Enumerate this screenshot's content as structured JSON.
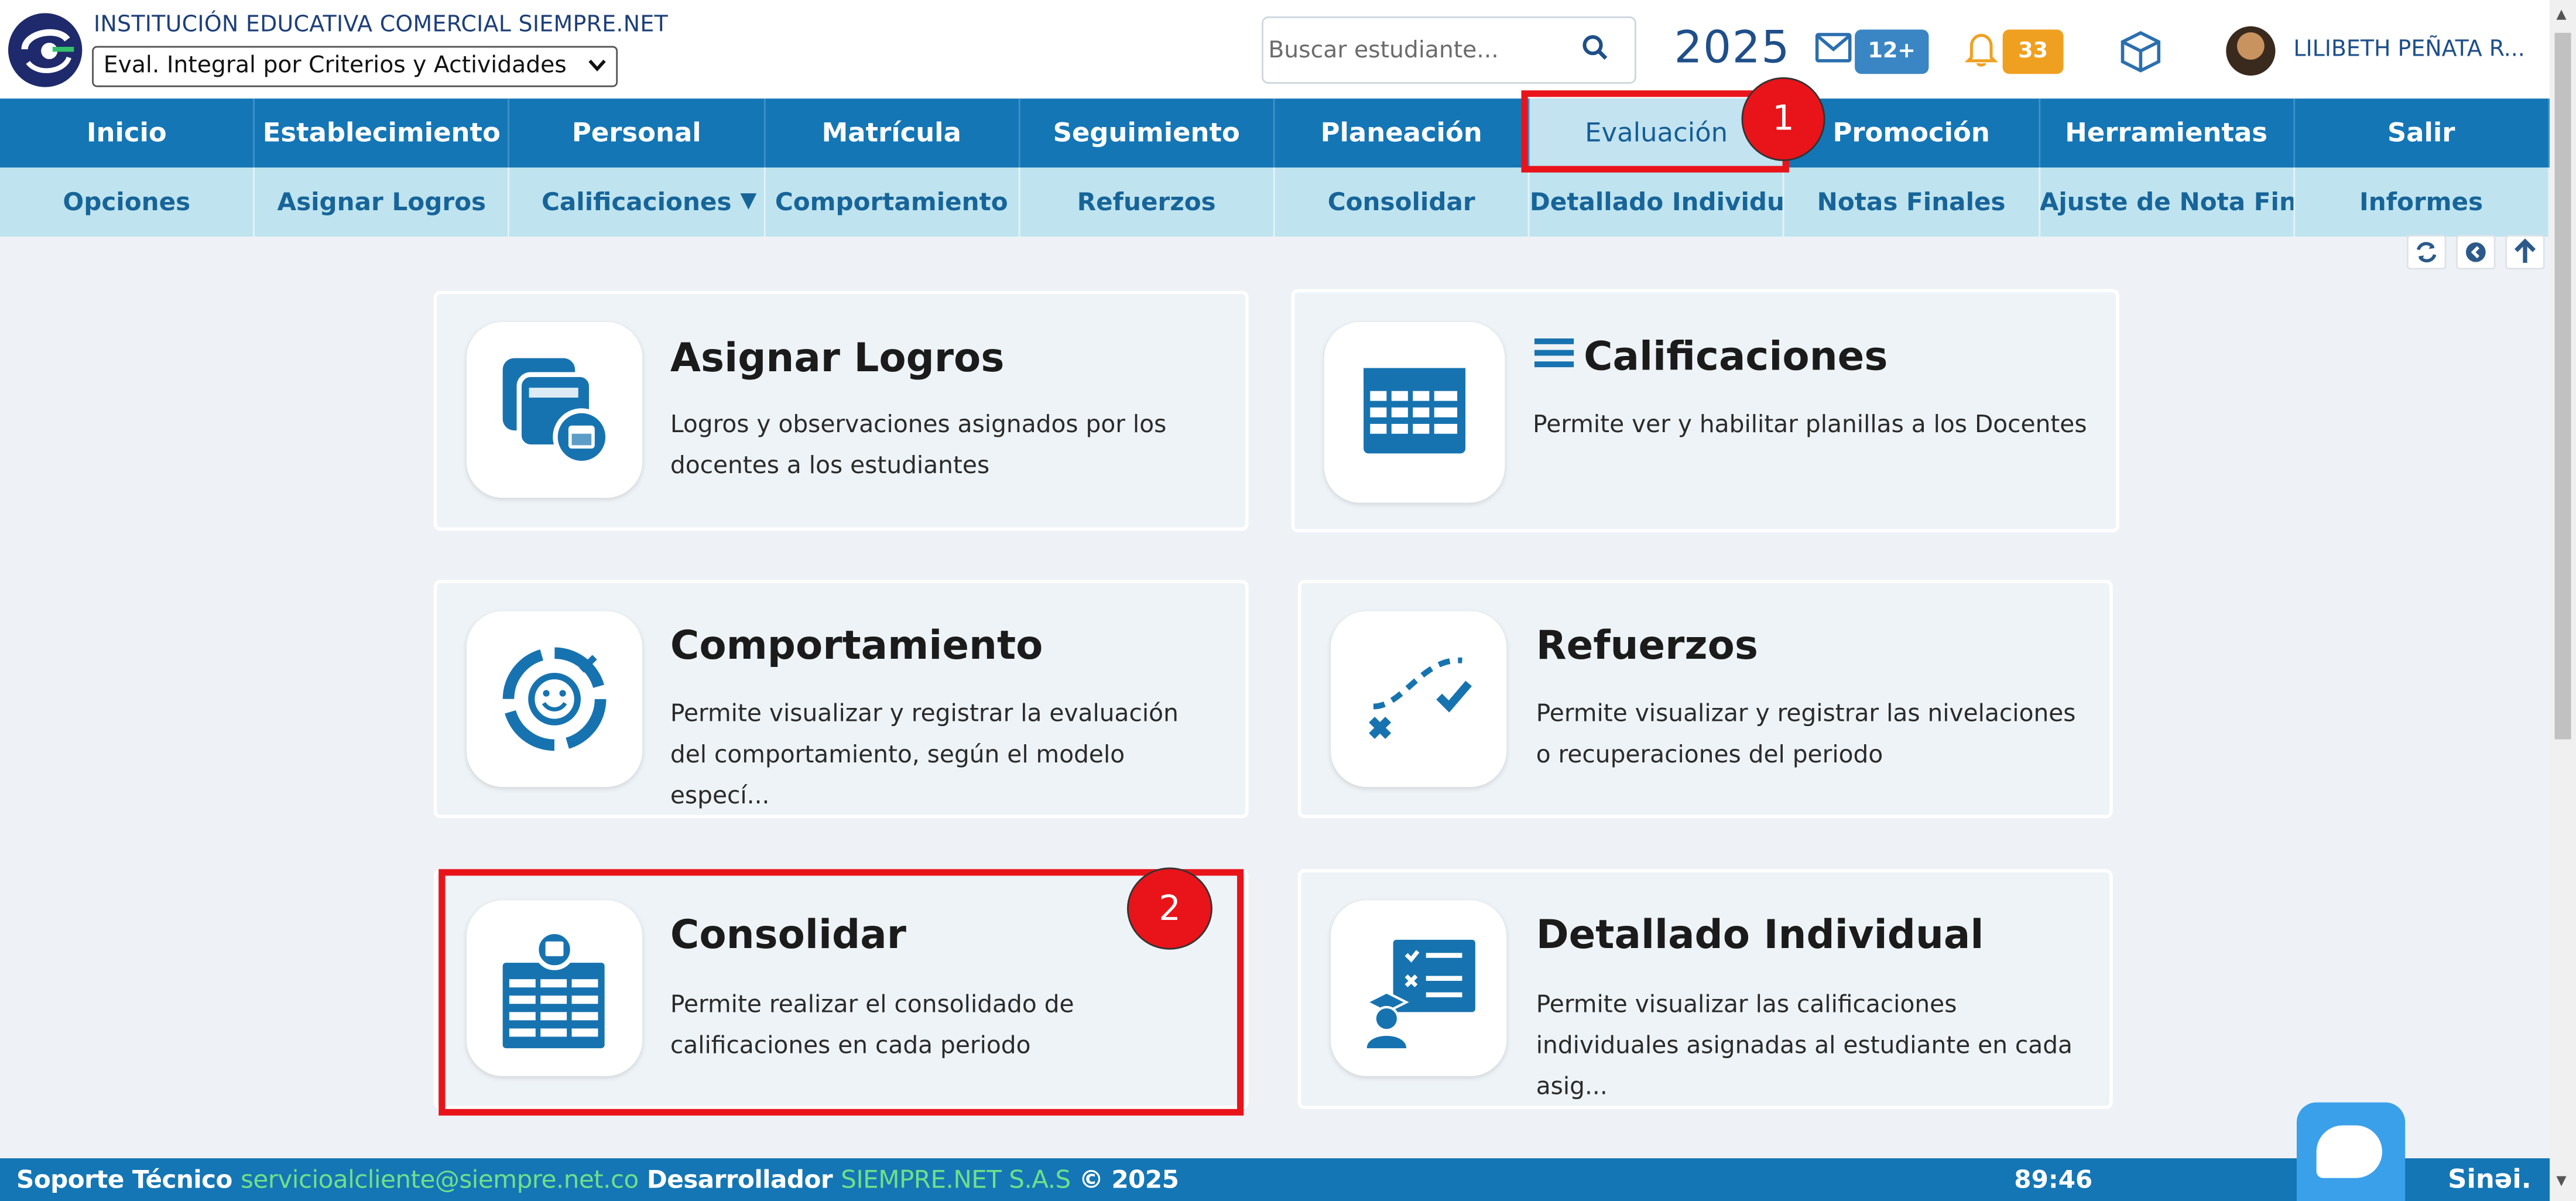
{
  "header": {
    "institution": "INSTITUCIÓN EDUCATIVA COMERCIAL SIEMPRE.NET",
    "eval_select": "Eval. Integral por Criterios y Actividades",
    "search_placeholder": "Buscar estudiante...",
    "year": "2025",
    "mail_badge": "12+",
    "notif_badge": "33",
    "user_name": "LILIBETH PEÑATA R..."
  },
  "main_nav": [
    {
      "label": "Inicio"
    },
    {
      "label": "Establecimiento"
    },
    {
      "label": "Personal"
    },
    {
      "label": "Matrícula"
    },
    {
      "label": "Seguimiento"
    },
    {
      "label": "Planeación"
    },
    {
      "label": "Evaluación"
    },
    {
      "label": "Promoción"
    },
    {
      "label": "Herramientas"
    },
    {
      "label": "Salir"
    }
  ],
  "sub_nav": [
    {
      "label": "Opciones"
    },
    {
      "label": "Asignar Logros"
    },
    {
      "label": "Calificaciones"
    },
    {
      "label": "Comportamiento"
    },
    {
      "label": "Refuerzos"
    },
    {
      "label": "Consolidar"
    },
    {
      "label": "Detallado Individual"
    },
    {
      "label": "Notas Finales"
    },
    {
      "label": "Ajuste de Nota Final"
    },
    {
      "label": "Informes"
    }
  ],
  "cards": [
    {
      "title": "Asignar Logros",
      "desc": "Logros y observaciones asignados por los docentes a los estudiantes"
    },
    {
      "title": "Calificaciones",
      "desc": "Permite ver y habilitar planillas a los Docentes"
    },
    {
      "title": "Comportamiento",
      "desc": "Permite visualizar y registrar la evaluación del comportamiento, según el modelo especí..."
    },
    {
      "title": "Refuerzos",
      "desc": "Permite visualizar y registrar las nivelaciones o recuperaciones del periodo"
    },
    {
      "title": "Consolidar",
      "desc": "Permite realizar el consolidado de calificaciones en cada periodo"
    },
    {
      "title": "Detallado Individual",
      "desc": "Permite visualizar las calificaciones individuales asignadas al estudiante en cada asig..."
    }
  ],
  "annotations": {
    "step1": "1",
    "step2": "2"
  },
  "footer": {
    "support_label": "Soporte Técnico",
    "support_email": "servicioalcliente@siempre.net.co",
    "dev_label": "Desarrollador",
    "dev_name": "SIEMPRE.NET S.A.S",
    "copyright": "© 2025",
    "timer": "89:46",
    "brand": "Sinəi."
  },
  "colors": {
    "nav_bg": "#1476b5",
    "subnav_bg": "#bfe4ef",
    "icon_blue": "#1773b0",
    "annotation_red": "#e8141a"
  },
  "icons": [
    "search-icon",
    "mail-icon",
    "bell-icon",
    "box-icon",
    "refresh-icon",
    "back-icon",
    "up-icon",
    "chat-icon",
    "hamburger-icon"
  ]
}
